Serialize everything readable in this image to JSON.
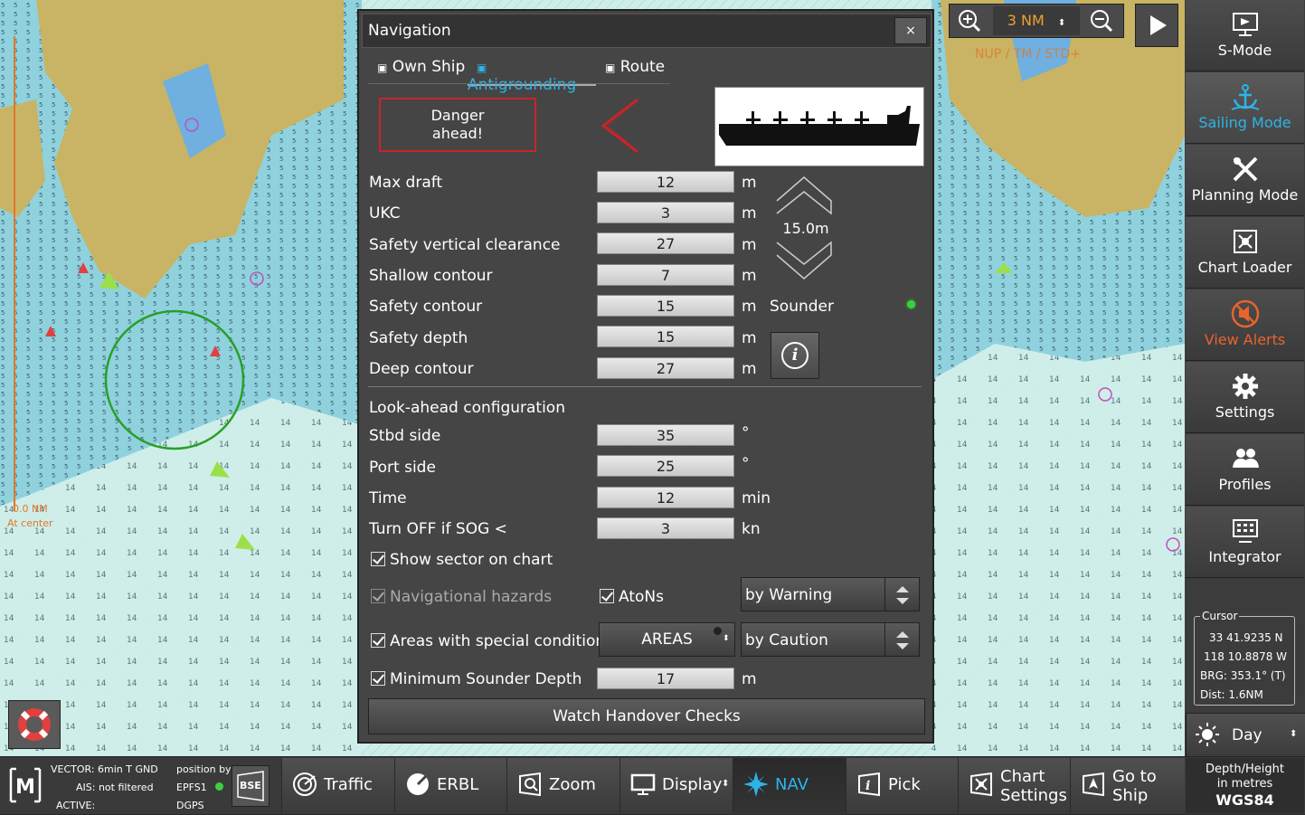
{
  "dialog": {
    "title": "Navigation",
    "close_symbol": "×",
    "tabs": [
      {
        "label": "Own Ship",
        "active": false
      },
      {
        "label": "Antigrounding",
        "active": true
      },
      {
        "label": "Route",
        "active": false
      }
    ],
    "danger_text_line1": "Danger",
    "danger_text_line2": "ahead!",
    "sounder_value": "15.0m",
    "sounder_label": "Sounder",
    "info_symbol": "i",
    "fields": [
      {
        "label": "Max draft",
        "value": "12",
        "unit": "m"
      },
      {
        "label": "UKC",
        "value": "3",
        "unit": "m"
      },
      {
        "label": "Safety vertical clearance",
        "value": "27",
        "unit": "m"
      },
      {
        "label": "Shallow contour",
        "value": "7",
        "unit": "m"
      },
      {
        "label": "Safety contour",
        "value": "15",
        "unit": "m"
      },
      {
        "label": "Safety depth",
        "value": "15",
        "unit": "m"
      },
      {
        "label": "Deep contour",
        "value": "27",
        "unit": "m"
      }
    ],
    "lookahead_heading": "Look-ahead configuration",
    "lookahead": [
      {
        "label": "Stbd side",
        "value": "35",
        "unit": "°"
      },
      {
        "label": "Port side",
        "value": "25",
        "unit": "°"
      },
      {
        "label": "Time",
        "value": "12",
        "unit": "min"
      },
      {
        "label": "Turn OFF if SOG <",
        "value": "3",
        "unit": "kn"
      }
    ],
    "show_sector": "Show sector on chart",
    "nav_hazards": "Navigational hazards",
    "atons": "AtoNs",
    "by_warning": "by Warning",
    "areas_special": "Areas with special conditions",
    "areas_button": "AREAS",
    "by_caution": "by Caution",
    "min_sounder_label": "Minimum Sounder Depth",
    "min_sounder_value": "17",
    "min_sounder_unit": "m",
    "watch_button": "Watch Handover Checks"
  },
  "zoom": {
    "range": "3 NM",
    "mode_text": "NUP / TM / STD+"
  },
  "chart_labels": {
    "range_ring": "0.0 NM",
    "at_center": "At center"
  },
  "right_panel": [
    {
      "label": "S-Mode",
      "icon": "s-mode-icon",
      "active": false
    },
    {
      "label": "Sailing Mode",
      "icon": "anchor-icon",
      "active": true
    },
    {
      "label": "Planning Mode",
      "icon": "planning-icon",
      "active": false
    },
    {
      "label": "Chart Loader",
      "icon": "chart-loader-icon",
      "active": false
    },
    {
      "label": "View Alerts",
      "icon": "alert-icon",
      "active": false
    },
    {
      "label": "Settings",
      "icon": "gear-icon",
      "active": false
    },
    {
      "label": "Profiles",
      "icon": "profiles-icon",
      "active": false
    },
    {
      "label": "Integrator",
      "icon": "integrator-icon",
      "active": false
    }
  ],
  "cursor": {
    "title": "Cursor",
    "lat": "33 41.9235 N",
    "lon": "118 10.8878 W",
    "brg": "BRG: 353.1° (T)",
    "dist": "Dist: 1.6NM"
  },
  "day_mode": "Day",
  "status": {
    "vector": "VECTOR: 6min T GND",
    "ais": "AIS: not filtered",
    "active": "ACTIVE:",
    "position_by": "position by",
    "epfs": "EPFS1",
    "dgps": "DGPS",
    "bse": "BSE"
  },
  "bottom_buttons": [
    {
      "label": "Traffic",
      "icon": "traffic-icon"
    },
    {
      "label": "ERBL",
      "icon": "erbl-icon"
    },
    {
      "label": "Zoom",
      "icon": "zoom-icon"
    },
    {
      "label": "Display",
      "icon": "display-icon"
    },
    {
      "label": "NAV",
      "icon": "nav-icon"
    },
    {
      "label": "Pick",
      "icon": "pick-icon"
    },
    {
      "label": "Chart Settings",
      "line1": "Chart",
      "line2": "Settings",
      "icon": "chart-settings-icon"
    },
    {
      "label": "Go to Ship",
      "line1": "Go to",
      "line2": "Ship",
      "icon": "go-to-ship-icon"
    }
  ],
  "depth_info": {
    "line1": "Depth/Height",
    "line2": "in metres",
    "datum": "WGS84"
  },
  "colors": {
    "accent": "#2db4e8",
    "danger": "#c8242a",
    "alert": "#e8642a",
    "land": "#c8b464",
    "water_shallow": "#8ad0e0",
    "water_deep": "#cdeeea"
  }
}
